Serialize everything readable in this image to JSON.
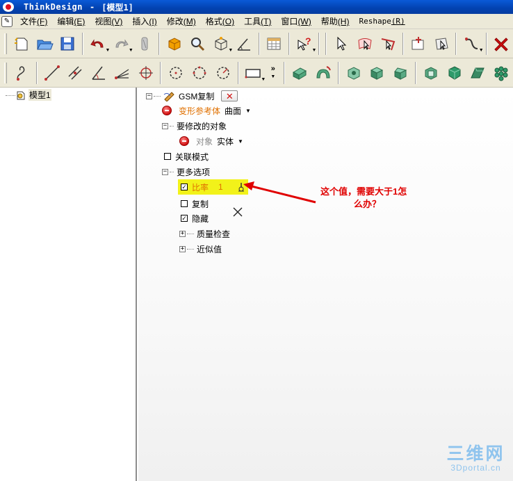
{
  "window": {
    "app_name": "ThinkDesign",
    "separator": "-",
    "doc_title": "[模型1]"
  },
  "menu": {
    "items": [
      {
        "label": "文件",
        "accel": "(F)"
      },
      {
        "label": "编辑",
        "accel": "(E)"
      },
      {
        "label": "视图",
        "accel": "(V)"
      },
      {
        "label": "插入",
        "accel": "(I)"
      },
      {
        "label": "修改",
        "accel": "(M)"
      },
      {
        "label": "格式",
        "accel": "(O)"
      },
      {
        "label": "工具",
        "accel": "(T)"
      },
      {
        "label": "窗口",
        "accel": "(W)"
      },
      {
        "label": "帮助",
        "accel": "(H)"
      },
      {
        "label": "Reshape",
        "accel": "(R)"
      }
    ]
  },
  "toolbar2": {
    "overflow_chevron": "»"
  },
  "tree": {
    "root_label": "模型1"
  },
  "panel": {
    "command_title": "GSM复制",
    "close_glyph": "✕",
    "deform_ref_label": "变形参考体",
    "deform_ref_value": "曲面",
    "modify_objects_label": "要修改的对象",
    "object_label": "对象",
    "object_value": "实体",
    "assoc_mode_label": "关联模式",
    "more_options_label": "更多选项",
    "ratio_label": "比率",
    "ratio_value": "1",
    "copy_label": "复制",
    "hide_label": "隐藏",
    "quality_check_label": "质量检查",
    "approx_value_label": "近似值"
  },
  "annotation": {
    "line1": "这个值，需要大于1怎",
    "line2": "么办？"
  },
  "watermark": {
    "big": "三维网",
    "small": "3Dportal.cn"
  },
  "colors": {
    "titlebar": "#0a5ad8",
    "highlight": "#f2f21a",
    "arrow": "#e00000",
    "orange_label": "#e07000"
  }
}
